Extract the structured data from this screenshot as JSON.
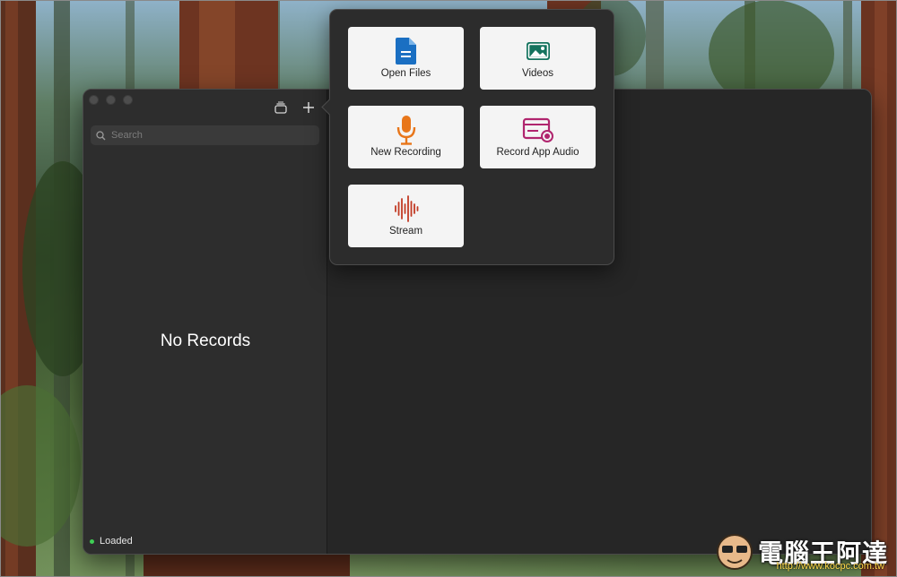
{
  "sidebar": {
    "search_placeholder": "Search",
    "empty_title": "No Records",
    "status_text": "Loaded",
    "status_color": "#3fcf55"
  },
  "toolbar": {
    "layers_icon": "stack-icon",
    "add_icon": "plus-icon"
  },
  "popover": {
    "items": [
      {
        "label": "Open Files",
        "icon": "document-icon",
        "color": "#1a6fc2"
      },
      {
        "label": "Videos",
        "icon": "image-icon",
        "color": "#14735e"
      },
      {
        "label": "New Recording",
        "icon": "microphone-icon",
        "color": "#e8761a"
      },
      {
        "label": "Record App Audio",
        "icon": "app-audio-icon",
        "color": "#b0256e"
      },
      {
        "label": "Stream",
        "icon": "waveform-icon",
        "color": "#c23a24"
      }
    ]
  },
  "watermark": {
    "brand": "電腦王阿達",
    "url": "http://www.kocpc.com.tw"
  }
}
